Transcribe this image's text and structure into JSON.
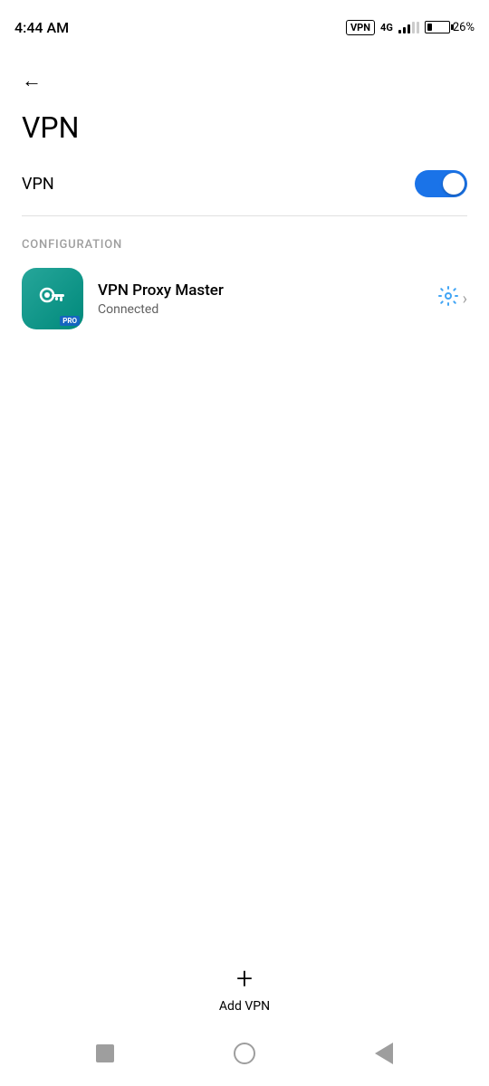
{
  "statusBar": {
    "time": "4:44 AM",
    "vpnLabel": "VPN",
    "batteryPercent": "26%"
  },
  "header": {
    "backLabel": "←",
    "title": "VPN"
  },
  "vpnToggle": {
    "label": "VPN",
    "enabled": true
  },
  "configuration": {
    "sectionLabel": "CONFIGURATION",
    "vpnApp": {
      "name": "VPN Proxy Master",
      "status": "Connected",
      "proBadge": "PRO"
    }
  },
  "addVpn": {
    "icon": "+",
    "label": "Add VPN"
  },
  "navBar": {
    "recent": "recent",
    "home": "home",
    "back": "back"
  }
}
